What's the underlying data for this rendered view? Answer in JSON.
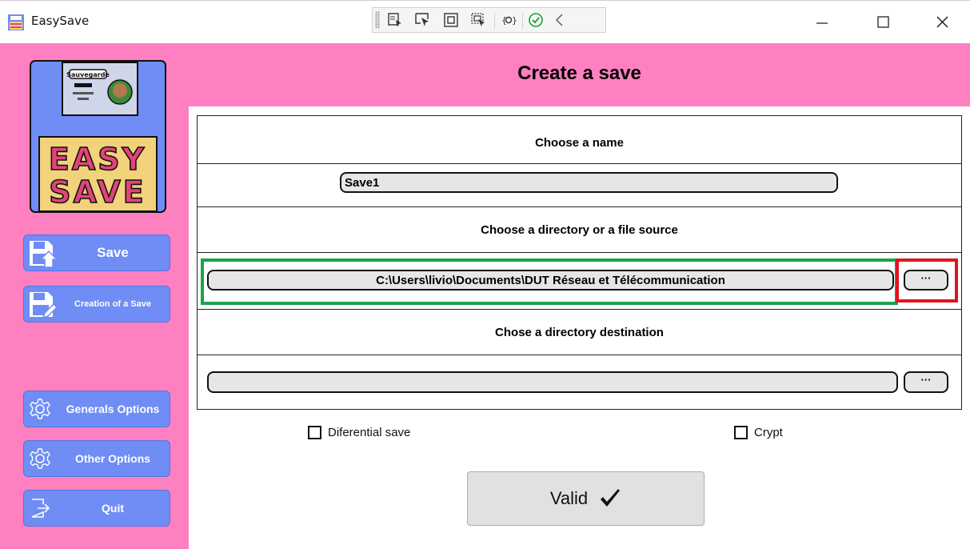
{
  "window": {
    "title": "EasySave",
    "debug_toolbar_icons": [
      "select-element-icon",
      "select-cursor-icon",
      "display-layout-adorners-icon",
      "track-focused-element-icon",
      "binding-failures-icon",
      "hot-reload-status-icon",
      "collapse-toolbar-icon"
    ],
    "controls": [
      "minimize-icon",
      "maximize-icon",
      "close-icon"
    ]
  },
  "sidebar": {
    "logo": {
      "top_text": "EASY",
      "bottom_text": "SAVE"
    },
    "buttons": [
      {
        "label": "Save",
        "icon": "save-disk-upload-icon"
      },
      {
        "label": "Creation of a Save",
        "icon": "save-disk-edit-icon"
      },
      {
        "label": "Generals Options",
        "icon": "gear-icon"
      },
      {
        "label": "Other Options",
        "icon": "gear-icon"
      },
      {
        "label": "Quit",
        "icon": "exit-icon"
      }
    ]
  },
  "main": {
    "title": "Create a save",
    "name_section": {
      "label": "Choose a name",
      "value": "Save1"
    },
    "source_section": {
      "label": "Choose a directory or a file source",
      "value": "C:\\Users\\livio\\Documents\\DUT Réseau et Télécommunication",
      "browse_label": "···"
    },
    "destination_section": {
      "label": "Chose a directory destination",
      "value": "",
      "browse_label": "···"
    },
    "options": {
      "differential": {
        "label": "Diferential save",
        "checked": false
      },
      "crypt": {
        "label": "Crypt",
        "checked": false
      }
    },
    "valid_button": {
      "label": "Valid",
      "icon": "checkmark-icon"
    }
  },
  "colors": {
    "sidebar_bg": "#ff80c0",
    "nav_button": "#6f8df5",
    "highlight_green": "#1aa34a",
    "highlight_red": "#e0141e"
  }
}
